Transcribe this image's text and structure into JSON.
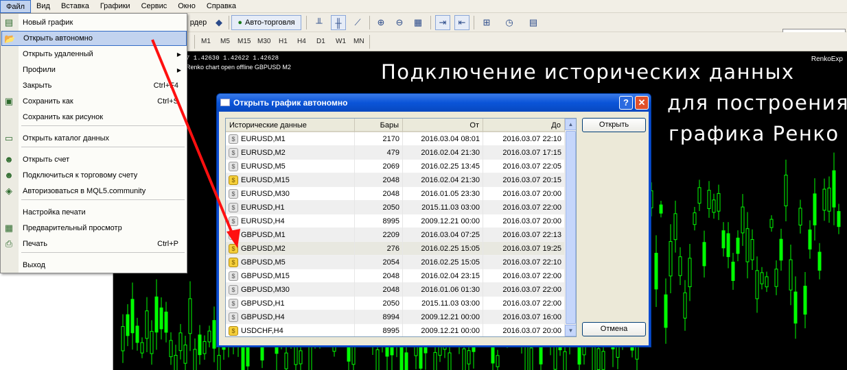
{
  "menubar": [
    "Файл",
    "Вид",
    "Вставка",
    "Графики",
    "Сервис",
    "Окно",
    "Справка"
  ],
  "toolbar": {
    "order_label": "рдер",
    "autotrading_label": "Авто-торговля",
    "timeframes": [
      "M1",
      "M5",
      "M15",
      "M30",
      "H1",
      "H4",
      "D1",
      "W1",
      "MN"
    ]
  },
  "chart": {
    "info_line1": "7 1.42630 1.42622 1.42628",
    "info_line2": "Renko chart open offline GBPUSD M2",
    "brand": "RenkoExp",
    "caption_line1": "Подключение исторических данных",
    "caption_line2": "для построения",
    "caption_line3": "графика Ренко"
  },
  "file_menu": [
    {
      "label": "Новый график",
      "shortcut": "",
      "icon": "new-chart-icon"
    },
    {
      "label": "Открыть автономно",
      "shortcut": "",
      "icon": "open-folder-icon",
      "highlighted": true
    },
    {
      "label": "Открыть удаленный",
      "shortcut": "",
      "submenu": true
    },
    {
      "label": "Профили",
      "shortcut": "",
      "submenu": true
    },
    {
      "label": "Закрыть",
      "shortcut": "Ctrl+F4"
    },
    {
      "label": "Сохранить как",
      "shortcut": "Ctrl+S",
      "icon": "save-icon"
    },
    {
      "label": "Сохранить как рисунок",
      "shortcut": ""
    },
    {
      "label": "Открыть каталог данных",
      "shortcut": "",
      "icon": "folder-icon"
    },
    {
      "label": "Открыть счет",
      "shortcut": "",
      "icon": "user-add-icon"
    },
    {
      "label": "Подключиться к торговому счету",
      "shortcut": "",
      "icon": "user-connect-icon"
    },
    {
      "label": "Авторизоваться в MQL5.community",
      "shortcut": "",
      "icon": "mql5-icon"
    },
    {
      "label": "Настройка печати",
      "shortcut": ""
    },
    {
      "label": "Предварительный просмотр",
      "shortcut": "",
      "icon": "print-preview-icon"
    },
    {
      "label": "Печать",
      "shortcut": "Ctrl+P",
      "icon": "printer-icon"
    },
    {
      "label": "Выход",
      "shortcut": ""
    }
  ],
  "dialog": {
    "title": "Открыть график автономно",
    "help_label": "?",
    "close_label": "✕",
    "columns": [
      "Исторические данные",
      "Бары",
      "От",
      "До"
    ],
    "open_button": "Открыть",
    "cancel_button": "Отмена",
    "rows": [
      {
        "symbol": "EURUSD,M1",
        "bars": "2170",
        "from": "2016.03.04 08:01",
        "to": "2016.03.07 22:10",
        "gold": false
      },
      {
        "symbol": "EURUSD,M2",
        "bars": "479",
        "from": "2016.02.04 21:30",
        "to": "2016.03.07 17:15",
        "gold": false
      },
      {
        "symbol": "EURUSD,M5",
        "bars": "2069",
        "from": "2016.02.25 13:45",
        "to": "2016.03.07 22:05",
        "gold": false
      },
      {
        "symbol": "EURUSD,M15",
        "bars": "2048",
        "from": "2016.02.04 21:30",
        "to": "2016.03.07 20:15",
        "gold": true
      },
      {
        "symbol": "EURUSD,M30",
        "bars": "2048",
        "from": "2016.01.05 23:30",
        "to": "2016.03.07 20:00",
        "gold": false
      },
      {
        "symbol": "EURUSD,H1",
        "bars": "2050",
        "from": "2015.11.03 03:00",
        "to": "2016.03.07 22:00",
        "gold": false
      },
      {
        "symbol": "EURUSD,H4",
        "bars": "8995",
        "from": "2009.12.21 00:00",
        "to": "2016.03.07 20:00",
        "gold": false
      },
      {
        "symbol": "GBPUSD,M1",
        "bars": "2209",
        "from": "2016.03.04 07:25",
        "to": "2016.03.07 22:13",
        "gold": false
      },
      {
        "symbol": "GBPUSD,M2",
        "bars": "276",
        "from": "2016.02.25 15:05",
        "to": "2016.03.07 19:25",
        "gold": true,
        "selected": true
      },
      {
        "symbol": "GBPUSD,M5",
        "bars": "2054",
        "from": "2016.02.25 15:05",
        "to": "2016.03.07 22:10",
        "gold": true
      },
      {
        "symbol": "GBPUSD,M15",
        "bars": "2048",
        "from": "2016.02.04 23:15",
        "to": "2016.03.07 22:00",
        "gold": false
      },
      {
        "symbol": "GBPUSD,M30",
        "bars": "2048",
        "from": "2016.01.06 01:30",
        "to": "2016.03.07 22:00",
        "gold": false
      },
      {
        "symbol": "GBPUSD,H1",
        "bars": "2050",
        "from": "2015.11.03 03:00",
        "to": "2016.03.07 22:00",
        "gold": false
      },
      {
        "symbol": "GBPUSD,H4",
        "bars": "8994",
        "from": "2009.12.21 00:00",
        "to": "2016.03.07 16:00",
        "gold": false
      },
      {
        "symbol": "USDCHF,H4",
        "bars": "8995",
        "from": "2009.12.21 00:00",
        "to": "2016.03.07 20:00",
        "gold": true
      }
    ]
  },
  "colors": {
    "accent": "#316ac5",
    "title_bar": "#0a54d8",
    "candle": "#00ff00",
    "arrow": "#ff0000"
  }
}
